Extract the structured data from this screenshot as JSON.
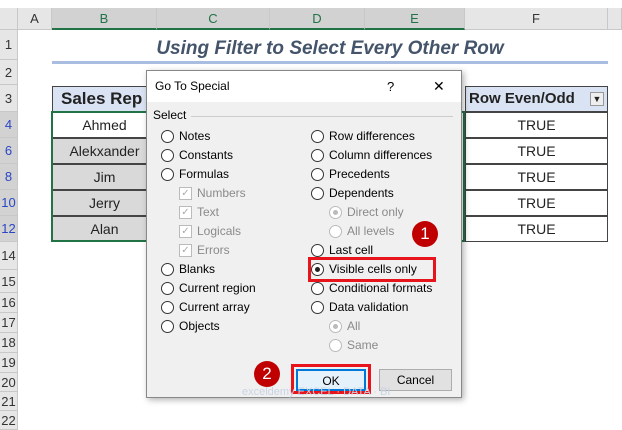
{
  "columns": [
    "A",
    "B",
    "C",
    "D",
    "E",
    "F"
  ],
  "rows": [
    "1",
    "2",
    "3",
    "4",
    "6",
    "8",
    "10",
    "12",
    "14",
    "15",
    "16",
    "17",
    "18",
    "19",
    "20",
    "21",
    "22"
  ],
  "sheet_title": "Using Filter to Select Every Other Row",
  "table": {
    "header_b": "Sales Rep",
    "header_f": "Row Even/Odd",
    "reps": [
      "Ahmed",
      "Alekxander",
      "Jim",
      "Jerry",
      "Alan"
    ],
    "values": [
      "TRUE",
      "TRUE",
      "TRUE",
      "TRUE",
      "TRUE"
    ]
  },
  "dialog": {
    "title": "Go To Special",
    "help": "?",
    "close": "✕",
    "group": "Select",
    "left": [
      "Notes",
      "Constants",
      "Formulas",
      "Numbers",
      "Text",
      "Logicals",
      "Errors",
      "Blanks",
      "Current region",
      "Current array",
      "Objects"
    ],
    "right": [
      "Row differences",
      "Column differences",
      "Precedents",
      "Dependents",
      "Direct only",
      "All levels",
      "Last cell",
      "Visible cells only",
      "Conditional formats",
      "Data validation",
      "All",
      "Same"
    ],
    "ok": "OK",
    "cancel": "Cancel"
  },
  "badges": [
    "1",
    "2"
  ],
  "watermark": "exceldemy EXCEL · DATA · BI",
  "colors": {
    "accent": "#217346",
    "badge": "#c00000",
    "highlight": "#e8141b"
  }
}
